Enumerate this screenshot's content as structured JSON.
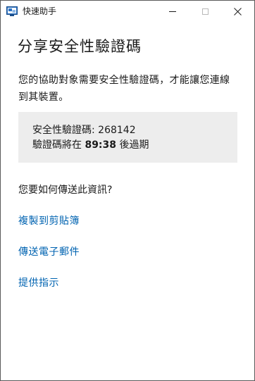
{
  "window": {
    "title": "快速助手",
    "icon": "quick-assist-icon",
    "controls": {
      "minimize_icon": "minimize-icon",
      "maximize_icon": "maximize-icon",
      "close_icon": "close-icon"
    }
  },
  "main": {
    "heading": "分享安全性驗證碼",
    "description": "您的協助對象需要安全性驗證碼，才能讓您連線到其裝置。",
    "code_box": {
      "code_label": "安全性驗證碼: ",
      "code_value": "268142",
      "expiry_prefix": "驗證碼將在 ",
      "expiry_time": "89:38",
      "expiry_suffix": " 後過期"
    },
    "question": "您要如何傳送此資訊?",
    "links": {
      "copy": "複製到剪貼簿",
      "email": "傳送電子郵件",
      "help": "提供指示"
    }
  },
  "colors": {
    "link": "#0063b1",
    "code_box_bg": "#ededed",
    "text": "#1a1a1a"
  }
}
